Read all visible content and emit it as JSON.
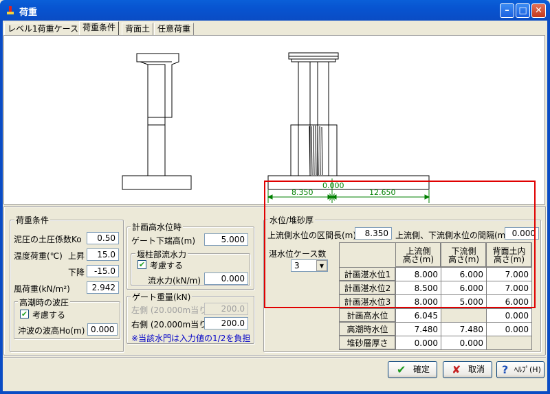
{
  "window": {
    "title": "荷重"
  },
  "tabs": [
    "レベル1荷重ケース",
    "荷重条件",
    "背面土",
    "任意荷重"
  ],
  "drawing": {
    "dim_left": "8.350",
    "dim_center": "0.000",
    "dim_right": "12.650"
  },
  "load": {
    "group_title": "荷重条件",
    "ko_label": "泥圧の土圧係数Ko",
    "ko_value": "0.50",
    "temp_label": "温度荷重(℃)",
    "rise_label": "上昇",
    "rise_value": "15.0",
    "fall_label": "下降",
    "fall_value": "-15.0",
    "wind_label": "風荷重(kN/m²)",
    "wind_value": "2.942",
    "tide": {
      "title": "高潮時の波圧",
      "consider_label": "考慮する",
      "consider_checked": true,
      "wave_label": "沖波の波高Ho(m)",
      "wave_value": "0.000"
    }
  },
  "hwl": {
    "group_title": "計画高水位時",
    "gate_label": "ゲート下端高(m)",
    "gate_value": "5.000",
    "weir": {
      "title": "堰柱部流水力",
      "consider_label": "考慮する",
      "consider_checked": true,
      "force_label": "流水力(kN/m)",
      "force_value": "0.000"
    }
  },
  "gate_weight": {
    "title": "ゲート重量(kN)",
    "left_label": "左側 (20.000m当り)",
    "left_value": "200.0",
    "right_label": "右側 (20.000m当り)",
    "right_value": "200.0",
    "note": "※当該水門は入力値の1/2を負担"
  },
  "water": {
    "group_title": "水位/堆砂厚",
    "up_len_label": "上流側水位の区間長(m)",
    "up_len_value": "8.350",
    "interval_label": "上流側、下流側水位の間隔(m)",
    "interval_value": "0.000",
    "case_label": "湛水位ケース数",
    "case_value": "3",
    "headers": [
      "上流側高さ(m)",
      "下流側高さ(m)",
      "背面土内高さ(m)"
    ],
    "rows": [
      {
        "label": "計画湛水位1",
        "values": [
          "8.000",
          "6.000",
          "7.000"
        ]
      },
      {
        "label": "計画湛水位2",
        "values": [
          "8.500",
          "6.000",
          "7.000"
        ]
      },
      {
        "label": "計画湛水位3",
        "values": [
          "8.000",
          "5.000",
          "6.000"
        ]
      },
      {
        "label": "計画高水位",
        "values": [
          "6.045",
          "",
          "0.000"
        ]
      },
      {
        "label": "高潮時水位",
        "values": [
          "7.480",
          "7.480",
          "0.000"
        ]
      },
      {
        "label": "堆砂層厚さ",
        "values": [
          "0.000",
          "0.000",
          ""
        ]
      }
    ]
  },
  "buttons": {
    "ok": "確定",
    "cancel": "取消",
    "help": "ﾍﾙﾌﾟ(H)"
  },
  "colors": {
    "highlight": "#E00000",
    "titlebar": "#0A4CC4"
  }
}
